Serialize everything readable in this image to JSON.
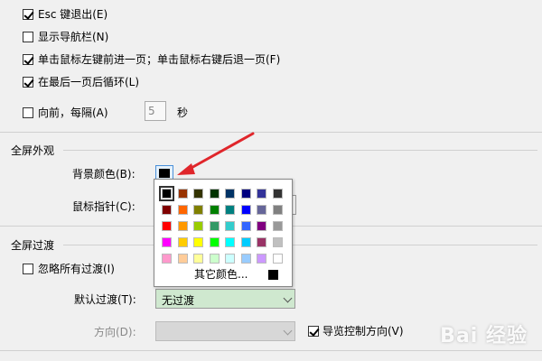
{
  "options": {
    "esc_exit": {
      "label": "Esc 键退出(E)",
      "checked": true
    },
    "show_nav": {
      "label": "显示导航栏(N)",
      "checked": false
    },
    "click_nav": {
      "label": "单击鼠标左键前进一页；单击鼠标右键后退一页(F)",
      "checked": true
    },
    "loop_last": {
      "label": "在最后一页后循环(L)",
      "checked": true
    },
    "forward": {
      "label": "向前，每隔(A)",
      "checked": false,
      "interval": "5",
      "unit": "秒"
    }
  },
  "fullscreen_appearance": {
    "title": "全屏外观",
    "bg_color_label": "背景颜色(B):",
    "pointer_label": "鼠标指针(C):"
  },
  "color_popup": {
    "more_colors": "其它颜色...",
    "grid": [
      [
        "#000000",
        "#993300",
        "#333300",
        "#003300",
        "#003366",
        "#000080",
        "#333399",
        "#333333"
      ],
      [
        "#800000",
        "#FF6600",
        "#808000",
        "#008000",
        "#008080",
        "#0000FF",
        "#666699",
        "#808080"
      ],
      [
        "#FF0000",
        "#FF9900",
        "#99CC00",
        "#339966",
        "#33CCCC",
        "#3366FF",
        "#800080",
        "#999999"
      ],
      [
        "#FF00FF",
        "#FFCC00",
        "#FFFF00",
        "#00FF00",
        "#00FFFF",
        "#00CCFF",
        "#993366",
        "#C0C0C0"
      ],
      [
        "#FF99CC",
        "#FFCC99",
        "#FFFF99",
        "#CCFFCC",
        "#CCFFFF",
        "#99CCFF",
        "#CC99FF",
        "#FFFFFF"
      ]
    ],
    "selected": "#000000"
  },
  "fullscreen_transition": {
    "title": "全屏过渡",
    "ignore_all": {
      "label": "忽略所有过渡(I)",
      "checked": false
    },
    "default_label": "默认过渡(T):",
    "default_value": "无过渡",
    "direction_label": "方向(D):",
    "nav_direction": {
      "label": "导览控制方向(V)",
      "checked": true
    }
  },
  "watermark": "Bai 经验"
}
